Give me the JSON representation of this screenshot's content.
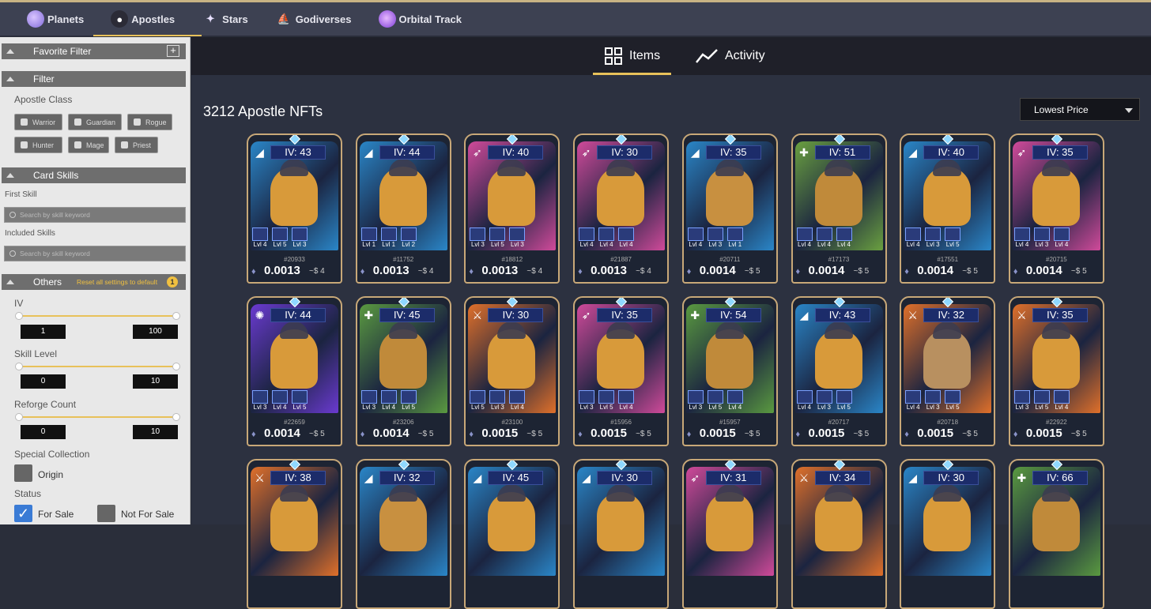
{
  "topnav": [
    {
      "label": "Planets",
      "icon": "planet-icon",
      "active": false
    },
    {
      "label": "Apostles",
      "icon": "apostle-icon",
      "active": true
    },
    {
      "label": "Stars",
      "icon": "star-icon",
      "active": false
    },
    {
      "label": "Godiverses",
      "icon": "godiverse-icon",
      "active": false
    },
    {
      "label": "Orbital Track",
      "icon": "orbital-track-icon",
      "active": false
    }
  ],
  "sidebar": {
    "favorite_filter": "Favorite Filter",
    "filter": "Filter",
    "apostle_class_label": "Apostle Class",
    "classes": [
      "Warrior",
      "Guardian",
      "Rogue",
      "Hunter",
      "Mage",
      "Priest"
    ],
    "card_skills": "Card Skills",
    "first_skill_label": "First Skill",
    "included_skills_label": "Included Skills",
    "skill_placeholder": "Search by skill keyword",
    "others": "Others",
    "reset_label": "Reset all settings to default",
    "reset_badge": "1",
    "iv_label": "IV",
    "iv_min": "1",
    "iv_max": "100",
    "skill_level_label": "Skill Level",
    "skill_min": "0",
    "skill_max": "10",
    "reforge_label": "Reforge Count",
    "reforge_min": "0",
    "reforge_max": "10",
    "special_collection_label": "Special Collection",
    "origin_label": "Origin",
    "status_label": "Status",
    "for_sale_label": "For Sale",
    "not_for_sale_label": "Not For Sale"
  },
  "tabs": {
    "items": "Items",
    "activity": "Activity"
  },
  "count_title": "3212 Apostle NFTs",
  "sort_label": "Lowest Price",
  "eth_symbol": "♦",
  "cards": [
    {
      "iv": "IV: 43",
      "cls": "guardian",
      "id": "#20933",
      "price": "0.0013",
      "usd": "~$ 4",
      "skills": [
        "Lvl 4",
        "Lvl 5",
        "Lvl 3"
      ],
      "bg": "#2a86c8",
      "fig": "#d89a3a"
    },
    {
      "iv": "IV: 44",
      "cls": "guardian",
      "id": "#11752",
      "price": "0.0013",
      "usd": "~$ 4",
      "skills": [
        "Lvl 1",
        "Lvl 1",
        "Lvl 2"
      ],
      "bg": "#2a86c8",
      "fig": "#d89a3a"
    },
    {
      "iv": "IV: 40",
      "cls": "hunter",
      "id": "#18812",
      "price": "0.0013",
      "usd": "~$ 4",
      "skills": [
        "Lvl 3",
        "Lvl 5",
        "Lvl 3"
      ],
      "bg": "#d04a9a",
      "fig": "#d89a3a"
    },
    {
      "iv": "IV: 30",
      "cls": "hunter",
      "id": "#21887",
      "price": "0.0013",
      "usd": "~$ 4",
      "skills": [
        "Lvl 4",
        "Lvl 4",
        "Lvl 4"
      ],
      "bg": "#d04a9a",
      "fig": "#d89a3a"
    },
    {
      "iv": "IV: 35",
      "cls": "guardian",
      "id": "#20711",
      "price": "0.0014",
      "usd": "~$ 5",
      "skills": [
        "Lvl 4",
        "Lvl 3",
        "Lvl 1"
      ],
      "bg": "#2a86c8",
      "fig": "#c89040"
    },
    {
      "iv": "IV: 51",
      "cls": "priest",
      "id": "#17173",
      "price": "0.0014",
      "usd": "~$ 5",
      "skills": [
        "Lvl 4",
        "Lvl 4",
        "Lvl 4"
      ],
      "bg": "#6aa040",
      "fig": "#c08a3a"
    },
    {
      "iv": "IV: 40",
      "cls": "guardian",
      "id": "#17551",
      "price": "0.0014",
      "usd": "~$ 5",
      "skills": [
        "Lvl 4",
        "Lvl 3",
        "Lvl 5"
      ],
      "bg": "#2a86c8",
      "fig": "#d89a3a"
    },
    {
      "iv": "IV: 35",
      "cls": "hunter",
      "id": "#20715",
      "price": "0.0014",
      "usd": "~$ 5",
      "skills": [
        "Lvl 4",
        "Lvl 3",
        "Lvl 4"
      ],
      "bg": "#d04a9a",
      "fig": "#d89a3a"
    },
    {
      "iv": "IV: 44",
      "cls": "mage",
      "id": "#22659",
      "price": "0.0014",
      "usd": "~$ 5",
      "skills": [
        "Lvl 3",
        "Lvl 4",
        "Lvl 5"
      ],
      "bg": "#6a3ad0",
      "fig": "#d89a3a"
    },
    {
      "iv": "IV: 45",
      "cls": "priest",
      "id": "#23206",
      "price": "0.0014",
      "usd": "~$ 5",
      "skills": [
        "Lvl 3",
        "Lvl 4",
        "Lvl 5"
      ],
      "bg": "#5a9a40",
      "fig": "#c08a3a"
    },
    {
      "iv": "IV: 30",
      "cls": "warrior",
      "id": "#23100",
      "price": "0.0015",
      "usd": "~$ 5",
      "skills": [
        "Lvl 5",
        "Lvl 3",
        "Lvl 4"
      ],
      "bg": "#e0702a",
      "fig": "#d89a3a"
    },
    {
      "iv": "IV: 35",
      "cls": "hunter",
      "id": "#15956",
      "price": "0.0015",
      "usd": "~$ 5",
      "skills": [
        "Lvl 3",
        "Lvl 5",
        "Lvl 4"
      ],
      "bg": "#d04a9a",
      "fig": "#d89a3a"
    },
    {
      "iv": "IV: 54",
      "cls": "priest",
      "id": "#15957",
      "price": "0.0015",
      "usd": "~$ 5",
      "skills": [
        "Lvl 3",
        "Lvl 5",
        "Lvl 4"
      ],
      "bg": "#5a9a40",
      "fig": "#c08a3a"
    },
    {
      "iv": "IV: 43",
      "cls": "guardian",
      "id": "#20717",
      "price": "0.0015",
      "usd": "~$ 5",
      "skills": [
        "Lvl 4",
        "Lvl 3",
        "Lvl 5"
      ],
      "bg": "#2a86c8",
      "fig": "#d89a3a"
    },
    {
      "iv": "IV: 32",
      "cls": "warrior",
      "id": "#20718",
      "price": "0.0015",
      "usd": "~$ 5",
      "skills": [
        "Lvl 4",
        "Lvl 3",
        "Lvl 5"
      ],
      "bg": "#e0702a",
      "fig": "#b89060"
    },
    {
      "iv": "IV: 35",
      "cls": "warrior",
      "id": "#22922",
      "price": "0.0015",
      "usd": "~$ 5",
      "skills": [
        "Lvl 3",
        "Lvl 5",
        "Lvl 4"
      ],
      "bg": "#e0702a",
      "fig": "#d89a3a"
    },
    {
      "iv": "IV: 38",
      "cls": "warrior",
      "bg": "#e0702a",
      "fig": "#d89a3a"
    },
    {
      "iv": "IV: 32",
      "cls": "guardian",
      "bg": "#2a86c8",
      "fig": "#c89040"
    },
    {
      "iv": "IV: 45",
      "cls": "guardian",
      "bg": "#2a86c8",
      "fig": "#d89a3a"
    },
    {
      "iv": "IV: 30",
      "cls": "guardian",
      "bg": "#2a86c8",
      "fig": "#d89a3a"
    },
    {
      "iv": "IV: 31",
      "cls": "hunter",
      "bg": "#d04a9a",
      "fig": "#d89a3a"
    },
    {
      "iv": "IV: 34",
      "cls": "warrior",
      "bg": "#e0702a",
      "fig": "#d89a3a"
    },
    {
      "iv": "IV: 30",
      "cls": "guardian",
      "bg": "#2a86c8",
      "fig": "#d89a3a"
    },
    {
      "iv": "IV: 66",
      "cls": "priest",
      "bg": "#5a9a40",
      "fig": "#c08a3a"
    }
  ]
}
